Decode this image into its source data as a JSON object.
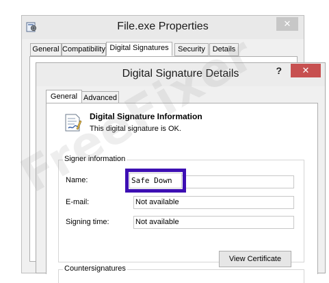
{
  "back_window": {
    "title": "File.exe Properties",
    "close_label": "✕",
    "tabs": [
      {
        "label": "General"
      },
      {
        "label": "Compatibility"
      },
      {
        "label": "Digital Signatures"
      },
      {
        "label": "Security"
      },
      {
        "label": "Details"
      }
    ]
  },
  "dialog": {
    "title": "Digital Signature Details",
    "help_label": "?",
    "close_label": "✕",
    "tabs": [
      {
        "label": "General"
      },
      {
        "label": "Advanced"
      }
    ],
    "info_title": "Digital Signature Information",
    "info_text": "This digital signature is OK.",
    "signer_group_label": "Signer information",
    "fields": {
      "name_label": "Name:",
      "name_value": "Safe Down",
      "email_label": "E-mail:",
      "email_value": "Not available",
      "signing_time_label": "Signing time:",
      "signing_time_value": "Not available"
    },
    "view_certificate_label": "View Certificate",
    "countersignatures_label": "Countersignatures"
  },
  "watermark": "FreeFixer",
  "colors": {
    "highlight": "#3d0fb3",
    "close_red": "#c75050"
  },
  "icons": {
    "app": "app-properties-icon",
    "info": "signed-document-icon"
  }
}
